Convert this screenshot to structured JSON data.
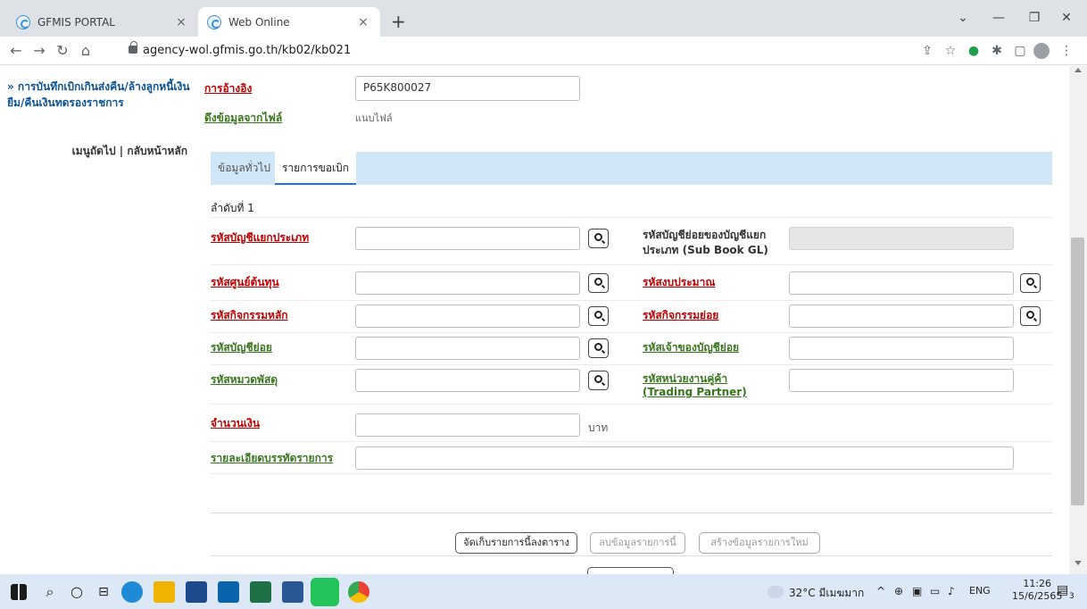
{
  "browser": {
    "tabs": [
      {
        "title": "GFMIS PORTAL",
        "close": "×"
      },
      {
        "title": "Web Online",
        "close": "×"
      }
    ],
    "new_tab": "+",
    "url": "agency-wol.gfmis.go.th/kb02/kb021",
    "window_controls": {
      "minimize": "—",
      "maximize": "❐",
      "close": "✕",
      "tablist": "⌄"
    }
  },
  "sidebar": {
    "title": "» การบันทึกเบิกเกินส่งคืน/ล้างลูกหนี้เงินยืม/คืนเงินทดรองราชการ",
    "link_next": "เมนูถัดไป",
    "separator": "|",
    "link_home": "กลับหน้าหลัก"
  },
  "header_fields": {
    "reference_label": "การอ้างอิง",
    "reference_value": "P65K800027",
    "import_label": "ดึงข้อมูลจากไฟล์",
    "import_value": "แนบไฟล์"
  },
  "tabs": {
    "general": "ข้อมูลทั่วไป",
    "detail": "รายการขอเบิก"
  },
  "sequence": "ลำดับที่ 1",
  "fields": {
    "gl_account": "รหัสบัญชีแยกประเภท",
    "sub_book_gl": "รหัสบัญชีย่อยของบัญชีแยกประเภท (Sub Book GL)",
    "cost_center": "รหัสศูนย์ต้นทุน",
    "budget_code": "รหัสงบประมาณ",
    "main_activity": "รหัสกิจกรรมหลัก",
    "sub_activity": "รหัสกิจกรรมย่อย",
    "sub_account": "รหัสบัญชีย่อย",
    "sub_account_owner": "รหัสเจ้าของบัญชีย่อย",
    "material_group": "รหัสหมวดพัสดุ",
    "trading_partner_1": "รหัสหน่วยงานคู่ค้า",
    "trading_partner_2": "(Trading Partner)",
    "amount": "จำนวนเงิน",
    "amount_unit": "บาท",
    "description": "รายละเอียดบรรทัดรายการ"
  },
  "buttons": {
    "save_to_table": "จัดเก็บรายการนี้ลงตาราง",
    "delete_item": "ลบข้อมูลรายการนี้",
    "new_item": "สร้างข้อมูลรายการใหม่"
  },
  "taskbar": {
    "weather": "32°C มีเมฆมาก",
    "language": "ENG",
    "time": "11:26",
    "date": "15/6/2565",
    "notifications": "3"
  }
}
